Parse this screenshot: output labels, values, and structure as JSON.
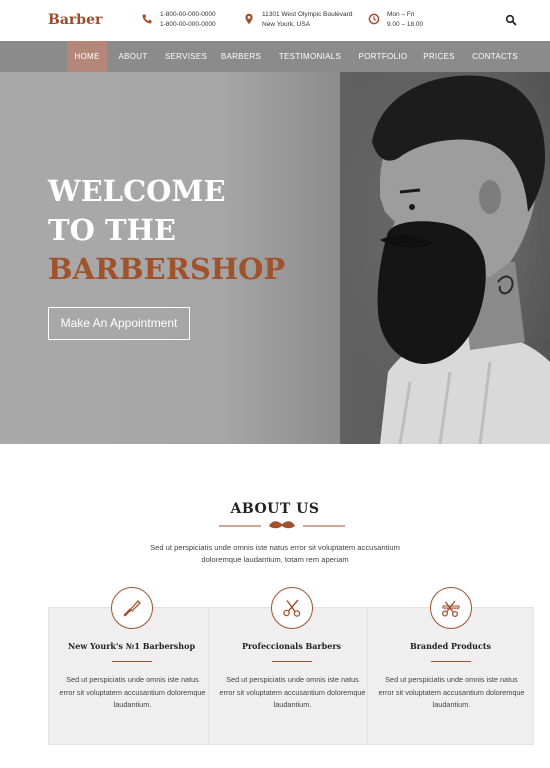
{
  "header": {
    "logo": "Barber",
    "phone": {
      "line1": "1-800-00-000-0000",
      "line2": "1-800-00-000-0000"
    },
    "address": {
      "line1": "11301 West Olympic Boulevard",
      "line2": "New Yourk, USA"
    },
    "hours": {
      "line1": "Mon – Fri",
      "line2": "9.00 – 18.00"
    }
  },
  "nav": {
    "items": [
      "HOME",
      "ABOUT",
      "SERVISES",
      "BARBERS",
      "TESTIMONIALS",
      "PORTFOLIO",
      "PRICES",
      "CONTACTS"
    ],
    "active": "HOME"
  },
  "hero": {
    "title_line1": "WELCOME",
    "title_line2": "TO THE",
    "title_line3": "BARBERSHOP",
    "button_label": "Make An Appointment"
  },
  "about": {
    "title": "ABOUT US",
    "text": "Sed ut perspiciatis unde omnis iste natus error sit voluptatem accusantium doloremque laudantium, totam rem aperiam",
    "cards": [
      {
        "icon": "razor-icon",
        "title": "New Yourk's №1 Barbershop",
        "text": "Sed ut perspiciatis unde omnis iste natus error sit voluptatem accusantium doloremque laudantium."
      },
      {
        "icon": "scissors-icon",
        "title": "Profeccionals Barbers",
        "text": "Sed ut perspiciatis unde omnis iste natus error sit voluptatem accusantium doloremque laudantium."
      },
      {
        "icon": "scissors-comb-icon",
        "title": "Branded Products",
        "text": "Sed ut perspiciatis unde omnis iste natus error sit voluptatem accusantium doloremque laudantium."
      }
    ]
  },
  "colors": {
    "accent": "#a0522d",
    "nav_bg": "#8b8b8b",
    "nav_active": "#b5867a"
  }
}
